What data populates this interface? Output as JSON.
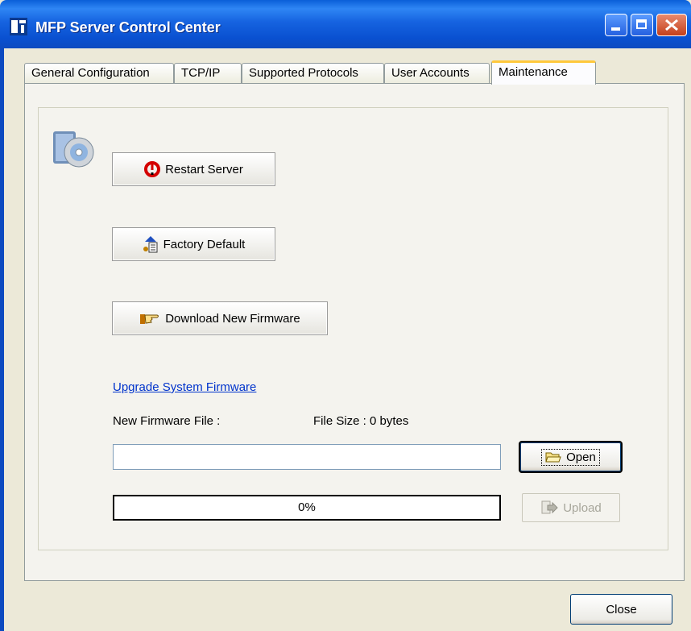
{
  "window": {
    "title": "MFP Server Control Center",
    "accent": "#0a5fd8"
  },
  "tabs": [
    {
      "label": "General Configuration",
      "active": false
    },
    {
      "label": "TCP/IP",
      "active": false
    },
    {
      "label": "Supported Protocols",
      "active": false
    },
    {
      "label": "User Accounts",
      "active": false
    },
    {
      "label": "Maintenance",
      "active": true
    }
  ],
  "maintenance": {
    "restart_label": "Restart Server",
    "factory_label": "Factory Default",
    "download_label": "Download New Firmware",
    "upgrade_link": "Upgrade System Firmware",
    "new_firmware_label": "New Firmware File :",
    "file_size_label": "File Size :  0 bytes",
    "firmware_file_value": "",
    "open_label": "Open",
    "upload_label": "Upload",
    "progress_text": "0%",
    "progress_fraction": 0
  },
  "footer": {
    "close_label": "Close"
  }
}
